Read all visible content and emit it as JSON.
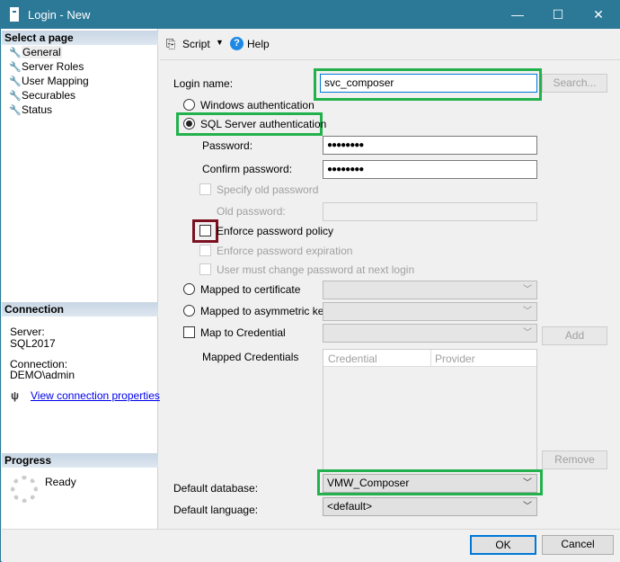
{
  "window": {
    "title": "Login - New",
    "minimize": "—",
    "maximize": "☐",
    "close": "✕"
  },
  "sidebar": {
    "select_page_header": "Select a page",
    "items": [
      {
        "label": "General"
      },
      {
        "label": "Server Roles"
      },
      {
        "label": "User Mapping"
      },
      {
        "label": "Securables"
      },
      {
        "label": "Status"
      }
    ],
    "connection_header": "Connection",
    "server_label": "Server:",
    "server_value": "SQL2017",
    "connection_label": "Connection:",
    "connection_value": "DEMO\\admin",
    "view_connection_link": "View connection properties",
    "progress_header": "Progress",
    "progress_status": "Ready"
  },
  "toolbar": {
    "script_label": "Script",
    "help_label": "Help"
  },
  "form": {
    "login_name_label": "Login name:",
    "login_name_value": "svc_composer",
    "search_button": "Search...",
    "windows_auth": "Windows authentication",
    "sql_auth": "SQL Server authentication",
    "password_label": "Password:",
    "password_value": "●●●●●●●●",
    "confirm_password_label": "Confirm password:",
    "confirm_password_value": "●●●●●●●●",
    "specify_old_password": "Specify old password",
    "old_password_label": "Old password:",
    "enforce_policy": "Enforce password policy",
    "enforce_expiration": "Enforce password expiration",
    "must_change": "User must change password at next login",
    "mapped_certificate": "Mapped to certificate",
    "mapped_asym_key": "Mapped to asymmetric key",
    "map_credential": "Map to Credential",
    "add_button": "Add",
    "mapped_credentials_label": "Mapped Credentials",
    "credentials_columns": [
      "Credential",
      "Provider"
    ],
    "remove_button": "Remove",
    "default_database_label": "Default database:",
    "default_database_value": "VMW_Composer",
    "default_language_label": "Default language:",
    "default_language_value": "<default>",
    "selected_auth": "sql",
    "enforce_policy_checked": false
  },
  "buttons": {
    "ok": "OK",
    "cancel": "Cancel"
  },
  "colors": {
    "titlebar": "#2b7897",
    "highlight_green": "#22b14c",
    "highlight_red": "#7a1020",
    "link": "#0000ee"
  }
}
